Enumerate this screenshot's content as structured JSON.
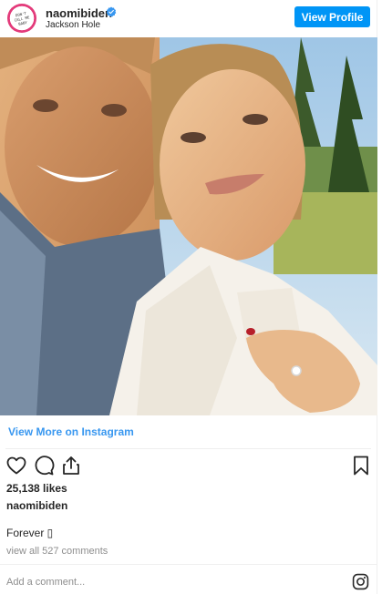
{
  "header": {
    "avatar_text": "DON'T CALL ME BABY",
    "username": "naomibiden",
    "location": "Jackson Hole",
    "view_profile_label": "View Profile"
  },
  "post": {
    "view_more_label": "View More on Instagram",
    "likes": "25,138 likes",
    "likes_user": "naomibiden",
    "caption": "Forever ▯",
    "comments_link": "view all 527 comments",
    "add_comment_placeholder": "Add a comment..."
  },
  "icons": {
    "verified": "verified-badge-icon",
    "like": "heart-icon",
    "comment": "comment-icon",
    "share": "share-icon",
    "save": "bookmark-icon",
    "brand": "instagram-icon"
  },
  "colors": {
    "accent": "#0095f6",
    "link": "#3897f0",
    "text": "#262626",
    "muted": "#8e8e8e"
  }
}
